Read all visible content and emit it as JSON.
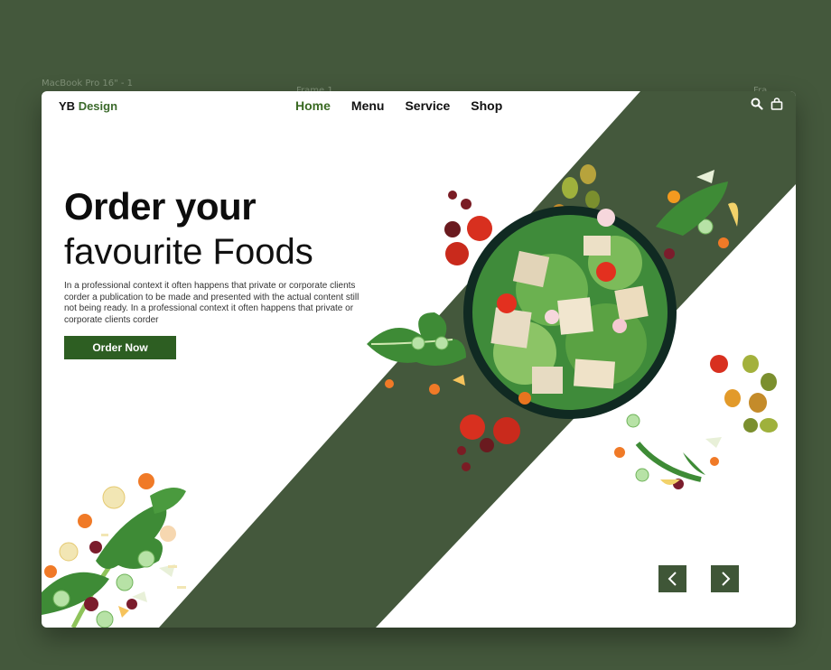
{
  "canvas_labels": {
    "device": "MacBook Pro 16\" - 1",
    "frame_1": "Frame 1",
    "frame_2": "Fra..."
  },
  "brand": {
    "prefix": "YB",
    "suffix": "Design"
  },
  "nav": {
    "items": [
      {
        "label": "Home",
        "active": true
      },
      {
        "label": "Menu",
        "active": false
      },
      {
        "label": "Service",
        "active": false
      },
      {
        "label": "Shop",
        "active": false
      }
    ],
    "icons": [
      "search-icon",
      "shopping-bag-icon"
    ]
  },
  "hero": {
    "title_line1": "Order your",
    "title_line2": "favourite Foods",
    "description": "In a professional context it often happens that private or corporate clients corder a publication to be made and presented with the actual content still not being ready. In a professional context it often happens that private or corporate clients corder",
    "cta_label": "Order Now"
  },
  "carousel": {
    "prev_icon": "chevron-left-icon",
    "next_icon": "chevron-right-icon"
  },
  "colors": {
    "background": "#44583c",
    "accent_green": "#2d5e22",
    "nav_active": "#3a6a22",
    "stripe_green": "#44583c"
  }
}
